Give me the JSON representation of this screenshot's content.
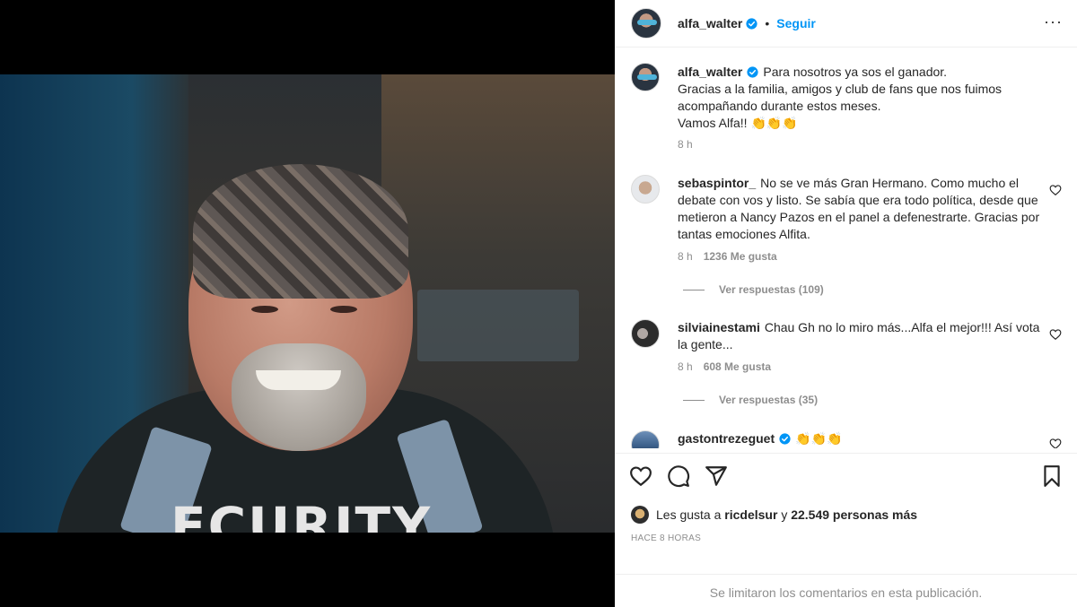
{
  "post": {
    "author": "alfa_walter",
    "follow_label": "Seguir",
    "dot": "•",
    "more": "···"
  },
  "caption": {
    "username": "alfa_walter",
    "lines": [
      "Para nosotros ya sos el ganador.",
      "Gracias a la familia, amigos y club de fans que nos fuimos acompañando durante estos meses.",
      "Vamos Alfa!! 👏👏👏"
    ],
    "time": "8 h"
  },
  "comments": [
    {
      "username": "sebaspintor_",
      "text": "No se ve más Gran Hermano. Como mucho el debate con vos y listo. Se sabía que era todo política, desde que metieron a Nancy Pazos en el panel a defenestrarte. Gracias por tantas emociones Alfita.",
      "time": "8 h",
      "likes": "1236 Me gusta",
      "replies": "Ver respuestas (109)"
    },
    {
      "username": "silviainestami",
      "text": "Chau Gh no lo miro más...Alfa el mejor!!! Así vota la gente...",
      "time": "8 h",
      "likes": "608 Me gusta",
      "replies": "Ver respuestas (35)"
    },
    {
      "username": "gastontrezeguet",
      "text": "👏👏👏"
    }
  ],
  "photo": {
    "shirt_text": "ECURITY"
  },
  "likes": {
    "prefix": "Les gusta a",
    "user": "ricdelsur",
    "joiner": "y",
    "others": "22.549 personas más"
  },
  "timestamp": "HACE 8 HORAS",
  "comments_limited": "Se limitaron los comentarios en esta publicación.",
  "colors": {
    "link": "#0095f6",
    "verified": "#0095f6",
    "muted": "#8e8e8e",
    "text": "#262626"
  }
}
